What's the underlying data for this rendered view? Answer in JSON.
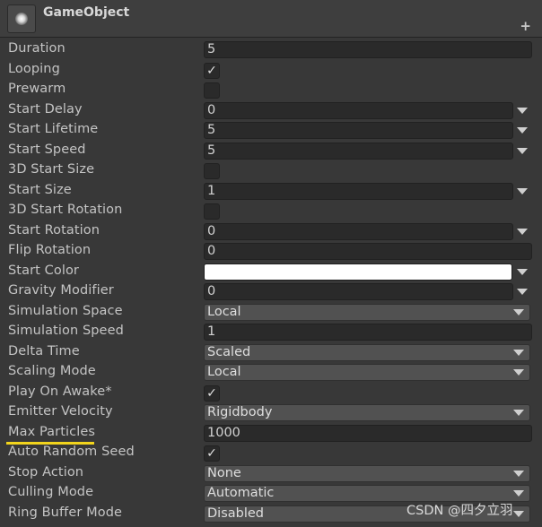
{
  "header": {
    "title": "GameObject",
    "plus_glyph": "+",
    "icon": "particle-system-icon"
  },
  "rows": [
    {
      "label": "Duration",
      "type": "field",
      "value": "5"
    },
    {
      "label": "Looping",
      "type": "checkbox",
      "checked": true
    },
    {
      "label": "Prewarm",
      "type": "checkbox",
      "checked": false
    },
    {
      "label": "Start Delay",
      "type": "curve",
      "value": "0"
    },
    {
      "label": "Start Lifetime",
      "type": "curve",
      "value": "5"
    },
    {
      "label": "Start Speed",
      "type": "curve",
      "value": "5"
    },
    {
      "label": "3D Start Size",
      "type": "checkbox",
      "checked": false
    },
    {
      "label": "Start Size",
      "type": "curve",
      "value": "1"
    },
    {
      "label": "3D Start Rotation",
      "type": "checkbox",
      "checked": false
    },
    {
      "label": "Start Rotation",
      "type": "curve",
      "value": "0"
    },
    {
      "label": "Flip Rotation",
      "type": "field",
      "value": "0"
    },
    {
      "label": "Start Color",
      "type": "color",
      "color": "#ffffff"
    },
    {
      "label": "Gravity Modifier",
      "type": "curve",
      "value": "0"
    },
    {
      "label": "Simulation Space",
      "type": "dropdown",
      "value": "Local"
    },
    {
      "label": "Simulation Speed",
      "type": "field",
      "value": "1"
    },
    {
      "label": "Delta Time",
      "type": "dropdown",
      "value": "Scaled"
    },
    {
      "label": "Scaling Mode",
      "type": "dropdown",
      "value": "Local"
    },
    {
      "label": "Play On Awake*",
      "type": "checkbox",
      "checked": true
    },
    {
      "label": "Emitter Velocity",
      "type": "dropdown",
      "value": "Rigidbody"
    },
    {
      "label": "Max Particles",
      "type": "field",
      "value": "1000",
      "highlight": true
    },
    {
      "label": "Auto Random Seed",
      "type": "checkbox",
      "checked": true
    },
    {
      "label": "Stop Action",
      "type": "dropdown",
      "value": "None"
    },
    {
      "label": "Culling Mode",
      "type": "dropdown",
      "value": "Automatic"
    },
    {
      "label": "Ring Buffer Mode",
      "type": "dropdown",
      "value": "Disabled"
    }
  ],
  "watermark": "CSDN @四夕立羽",
  "colors": {
    "panel_bg": "#383838",
    "field_bg": "#2a2a2a",
    "dropdown_bg": "#515151",
    "highlight_underline": "#f2d41d"
  }
}
